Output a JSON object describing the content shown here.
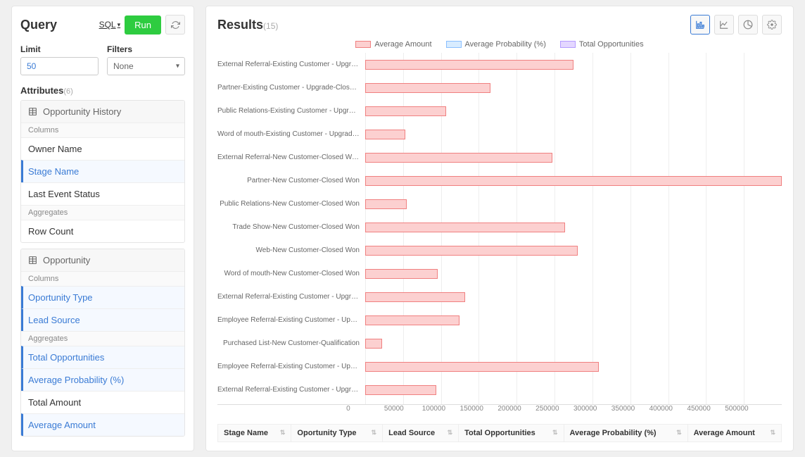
{
  "query_panel": {
    "title": "Query",
    "sql_link": "SQL",
    "run_button": "Run",
    "limit_label": "Limit",
    "limit_value": "50",
    "filters_label": "Filters",
    "filters_value": "None",
    "attributes_label": "Attributes",
    "attributes_count": "(6)"
  },
  "attributes": [
    {
      "header": "Opportunity History",
      "columns_label": "Columns",
      "aggregates_label": "Aggregates",
      "columns": [
        {
          "label": "Owner Name",
          "selected": false
        },
        {
          "label": "Stage Name",
          "selected": true
        },
        {
          "label": "Last Event Status",
          "selected": false
        }
      ],
      "aggregates": [
        {
          "label": "Row Count",
          "selected": false
        }
      ]
    },
    {
      "header": "Opportunity",
      "columns_label": "Columns",
      "aggregates_label": "Aggregates",
      "columns": [
        {
          "label": "Oportunity Type",
          "selected": true
        },
        {
          "label": "Lead Source",
          "selected": true
        }
      ],
      "aggregates": [
        {
          "label": "Total Opportunities",
          "selected": true
        },
        {
          "label": "Average Probability (%)",
          "selected": true
        },
        {
          "label": "Total Amount",
          "selected": false
        },
        {
          "label": "Average Amount",
          "selected": true
        }
      ]
    }
  ],
  "results_panel": {
    "title": "Results",
    "count": "(15)"
  },
  "legend": [
    {
      "label": "Average Amount",
      "fill": "#fcd0d0",
      "stroke": "#f08080"
    },
    {
      "label": "Average Probability (%)",
      "fill": "#d8ecff",
      "stroke": "#8abfff"
    },
    {
      "label": "Total Opportunities",
      "fill": "#e4d7ff",
      "stroke": "#b59cff"
    }
  ],
  "chart_data": {
    "type": "bar",
    "orientation": "horizontal",
    "xlabel": "",
    "ylabel": "",
    "xlim": [
      0,
      500000
    ],
    "x_ticks": [
      "0",
      "50000",
      "100000",
      "150000",
      "200000",
      "250000",
      "300000",
      "350000",
      "400000",
      "450000",
      "500000"
    ],
    "categories": [
      "External Referral-Existing Customer - Upgrade-Clos…",
      "Partner-Existing Customer - Upgrade-Closed Won",
      "Public Relations-Existing Customer - Upgrade-Close…",
      "Word of mouth-Existing Customer - Upgrade-Closed W…",
      "External Referral-New Customer-Closed Won",
      "Partner-New Customer-Closed Won",
      "Public Relations-New Customer-Closed Won",
      "Trade Show-New Customer-Closed Won",
      "Web-New Customer-Closed Won",
      "Word of mouth-New Customer-Closed Won",
      "External Referral-Existing Customer - Upgrade-Perc…",
      "Employee Referral-Existing Customer - Upgrade-Prop…",
      "Purchased List-New Customer-Qualification",
      "Employee Referral-Existing Customer - Upgrade-Valu…",
      "External Referral-Existing Customer - Upgrade-Valu…"
    ],
    "series": [
      {
        "name": "Average Amount",
        "fill": "#fcd0d0",
        "stroke": "#f08080",
        "values": [
          250000,
          150000,
          97000,
          48000,
          225000,
          500000,
          50000,
          240000,
          255000,
          87000,
          120000,
          113000,
          20000,
          280000,
          85000
        ]
      }
    ]
  },
  "table": {
    "columns": [
      "Stage Name",
      "Oportunity Type",
      "Lead Source",
      "Total Opportunities",
      "Average Probability (%)",
      "Average Amount"
    ]
  }
}
